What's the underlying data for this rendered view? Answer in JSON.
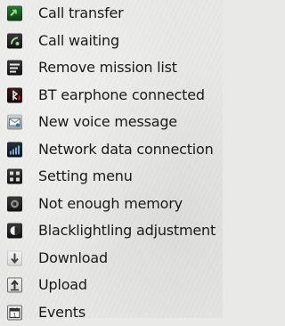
{
  "items": [
    {
      "label": "Call transfer",
      "icon": "call-transfer-icon"
    },
    {
      "label": "Call waiting",
      "icon": "call-waiting-icon"
    },
    {
      "label": "Remove mission list",
      "icon": "remove-mission-list-icon"
    },
    {
      "label": "BT earphone connected",
      "icon": "bt-earphone-icon"
    },
    {
      "label": "New voice message",
      "icon": "voice-message-icon"
    },
    {
      "label": "Network data connection",
      "icon": "network-data-icon"
    },
    {
      "label": "Setting menu",
      "icon": "setting-menu-icon"
    },
    {
      "label": "Not enough memory",
      "icon": "memory-warning-icon"
    },
    {
      "label": "Blacklightling adjustment",
      "icon": "backlight-icon"
    },
    {
      "label": "Download",
      "icon": "download-icon"
    },
    {
      "label": "Upload",
      "icon": "upload-icon"
    },
    {
      "label": "Events",
      "icon": "events-icon"
    }
  ]
}
